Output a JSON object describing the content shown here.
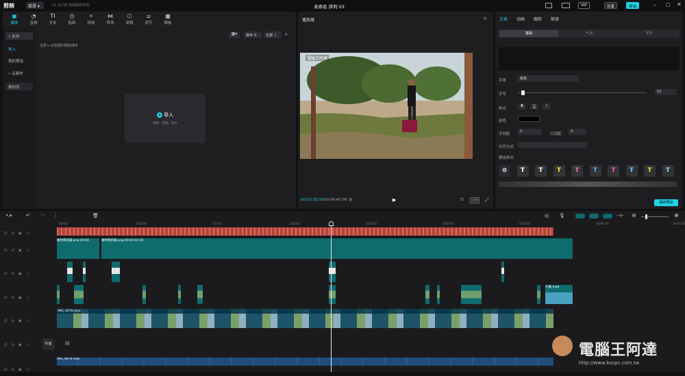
{
  "app": {
    "name": "剪映",
    "menu": "菜单",
    "autosave": "11:32:58 自动保存本地",
    "project_title": "未命名 序列 03",
    "vip": "VIP",
    "share": "分享",
    "export": "导出"
  },
  "media": {
    "tools": [
      {
        "label": "媒体",
        "active": true
      },
      {
        "label": "音频"
      },
      {
        "label": "文本"
      },
      {
        "label": "贴纸"
      },
      {
        "label": "特效"
      },
      {
        "label": "转场"
      },
      {
        "label": "滤镜"
      },
      {
        "label": "调节"
      },
      {
        "label": "模板"
      }
    ],
    "side": [
      "• 本地",
      "导入",
      "我的预设",
      "• 云素材",
      "素材库"
    ],
    "sort": "排序",
    "filter": "全部",
    "breadcrumb": "全部 ▸ 动态图形模板媒体",
    "import": "导入",
    "import_hint": "视频、音频、图片"
  },
  "player": {
    "title": "播放器",
    "current": "00:02:32:19",
    "total": "00:04:47:09",
    "ratio": "比例",
    "watermark": "電腦王阿達"
  },
  "inspector": {
    "tabs": [
      "文本",
      "动画",
      "跟踪",
      "朗读"
    ],
    "subtabs": [
      "基础",
      "气泡",
      "花字"
    ],
    "font_label": "字体",
    "font_value": "系统",
    "size_label": "字号",
    "size_value": "15",
    "style_label": "样式",
    "color_label": "颜色",
    "spacing_label": "字间距",
    "spacing_value": "0",
    "line_label": "行间距",
    "line_value": "0",
    "align_label": "对齐方式",
    "preset_label": "预设样式",
    "save_preset": "保存预设"
  },
  "timeline": {
    "ticks": [
      "00:00",
      "100:00",
      "10:30",
      "200:00",
      "300:00",
      "400:00",
      "500:00",
      "1000:00",
      "1030:00"
    ],
    "sticker_row1": [
      "素材库剪辑.png 00:00",
      "素材库剪辑.png 00:04:02:16"
    ],
    "video_label": "IMG_0678.mov",
    "video_row2": "IMG_0678.mov",
    "overlay": "片尾.mp4",
    "cover": "封面"
  },
  "branding": {
    "site": "電腦王阿達",
    "url": "http://www.kocpc.com.tw"
  },
  "colors": {
    "accent": "#1fd3e5",
    "red_track": "#b5433a"
  }
}
